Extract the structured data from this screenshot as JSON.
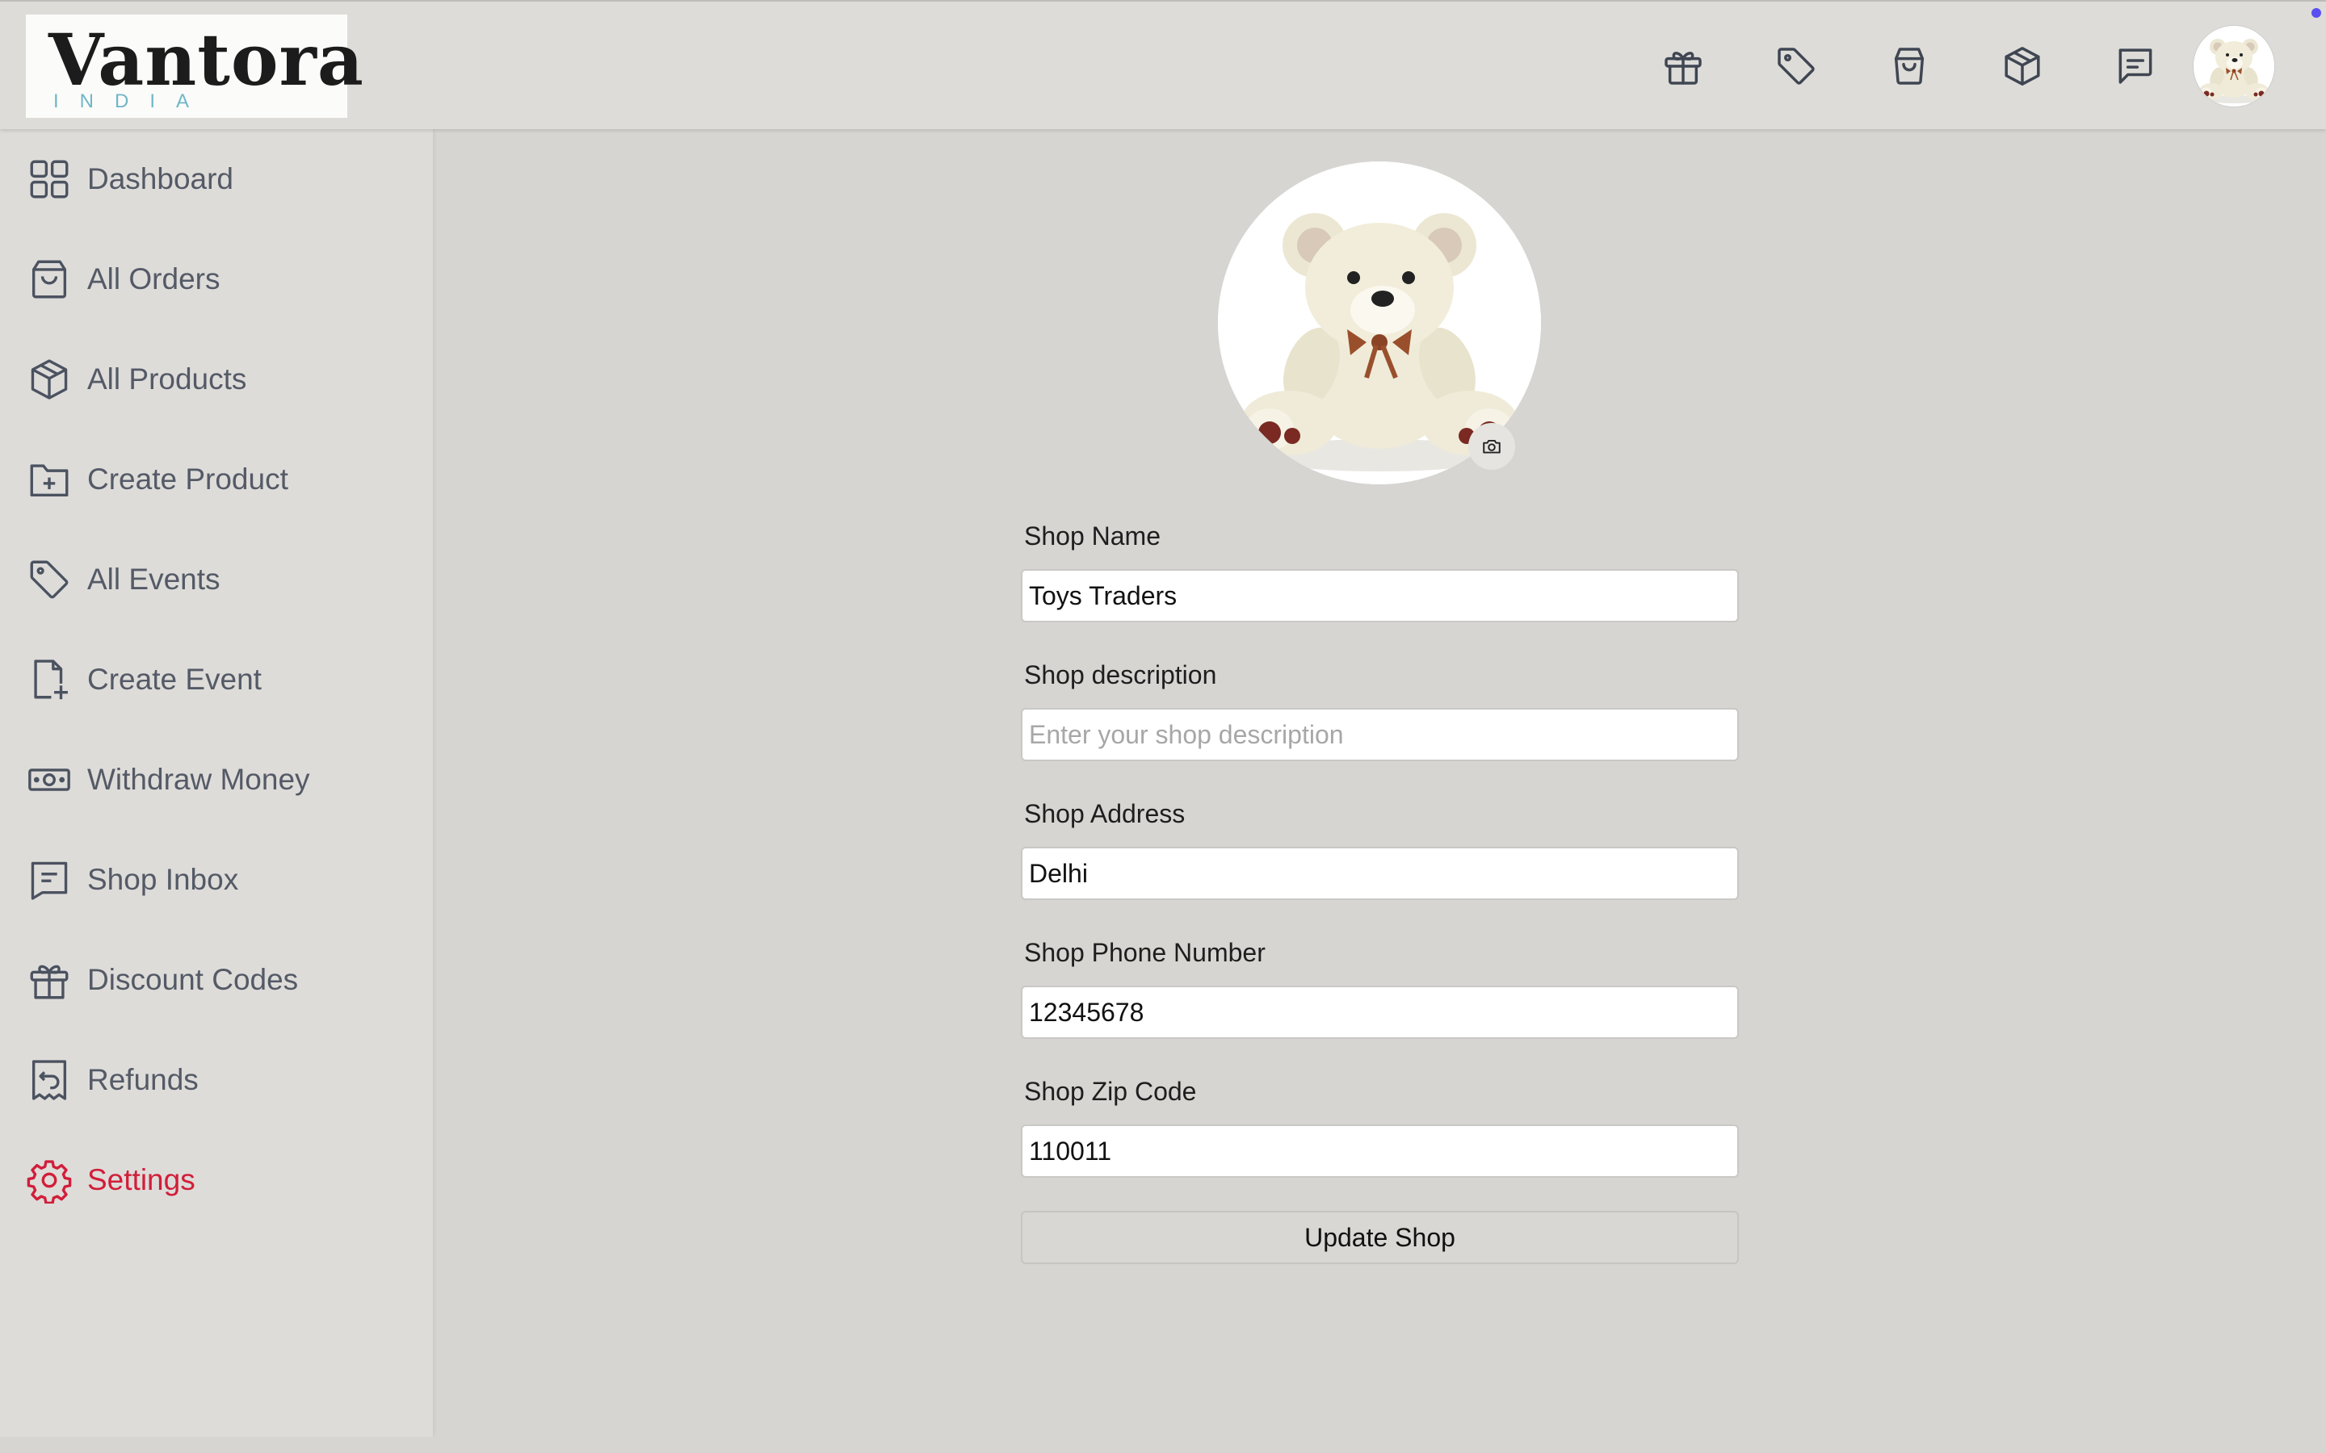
{
  "brand": {
    "name": "Vantora",
    "tagline": "INDIA"
  },
  "header": {
    "icons": [
      "gift-icon",
      "tag-icon",
      "shopping-bag-icon",
      "package-icon",
      "message-icon"
    ],
    "avatar": "teddy-bear-avatar"
  },
  "sidebar": {
    "items": [
      {
        "label": "Dashboard",
        "icon": "grid-icon"
      },
      {
        "label": "All Orders",
        "icon": "shopping-bag-icon"
      },
      {
        "label": "All Products",
        "icon": "package-icon"
      },
      {
        "label": "Create Product",
        "icon": "folder-plus-icon"
      },
      {
        "label": "All Events",
        "icon": "tag-icon"
      },
      {
        "label": "Create Event",
        "icon": "file-plus-icon"
      },
      {
        "label": "Withdraw Money",
        "icon": "money-icon"
      },
      {
        "label": "Shop Inbox",
        "icon": "message-icon"
      },
      {
        "label": "Discount Codes",
        "icon": "gift-icon"
      },
      {
        "label": "Refunds",
        "icon": "receipt-refund-icon"
      },
      {
        "label": "Settings",
        "icon": "gear-icon"
      }
    ],
    "active": "Settings",
    "active_color": "#d11e3a"
  },
  "form": {
    "shop_name": {
      "label": "Shop Name",
      "value": "Toys Traders"
    },
    "description": {
      "label": "Shop description",
      "value": "",
      "placeholder": "Enter your shop description"
    },
    "address": {
      "label": "Shop Address",
      "value": "Delhi"
    },
    "phone": {
      "label": "Shop Phone Number",
      "value": "12345678"
    },
    "zip": {
      "label": "Shop Zip Code",
      "value": "110011"
    },
    "submit_label": "Update Shop"
  },
  "photo": {
    "image": "teddy-bear",
    "camera_icon": "camera-icon"
  }
}
